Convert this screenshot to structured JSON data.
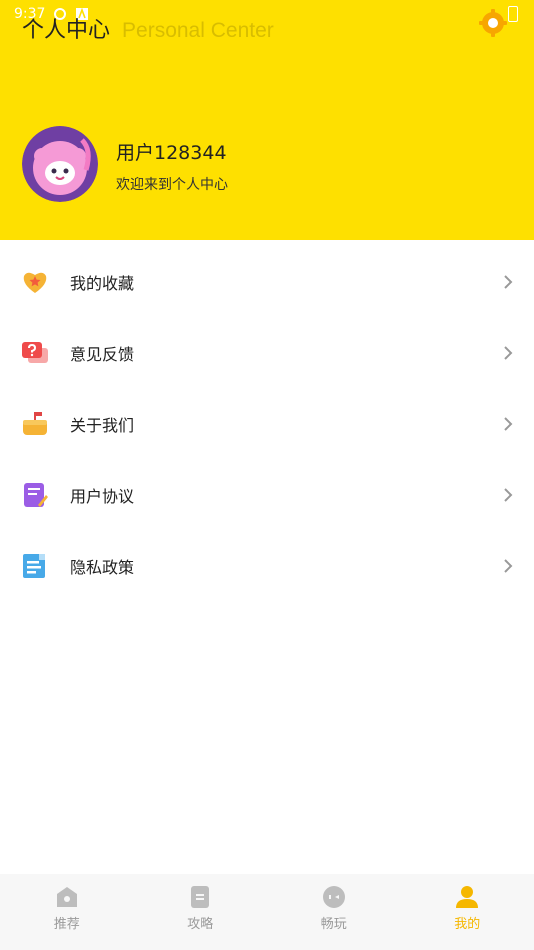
{
  "status_bar": {
    "time": "9:37"
  },
  "header": {
    "title": "个人中心",
    "subtitle": "Personal Center",
    "settings_icon": "gear-icon",
    "background_color": "#FEE000"
  },
  "profile": {
    "username": "用户128344",
    "welcome": "欢迎来到个人中心",
    "avatar_icon": "pink-monster-avatar"
  },
  "menu": {
    "items": [
      {
        "label": "我的收藏",
        "icon": "heart-star-icon"
      },
      {
        "label": "意见反馈",
        "icon": "question-chat-icon"
      },
      {
        "label": "关于我们",
        "icon": "mailbox-icon"
      },
      {
        "label": "用户协议",
        "icon": "document-pen-icon"
      },
      {
        "label": "隐私政策",
        "icon": "policy-list-icon"
      }
    ]
  },
  "tabbar": {
    "tabs": [
      {
        "label": "推荐",
        "icon": "home-icon",
        "active": false
      },
      {
        "label": "攻略",
        "icon": "guide-icon",
        "active": false
      },
      {
        "label": "畅玩",
        "icon": "play-icon",
        "active": false
      },
      {
        "label": "我的",
        "icon": "profile-icon",
        "active": true
      }
    ],
    "active_color": "#F5B700",
    "inactive_color": "#9a9a9a"
  }
}
